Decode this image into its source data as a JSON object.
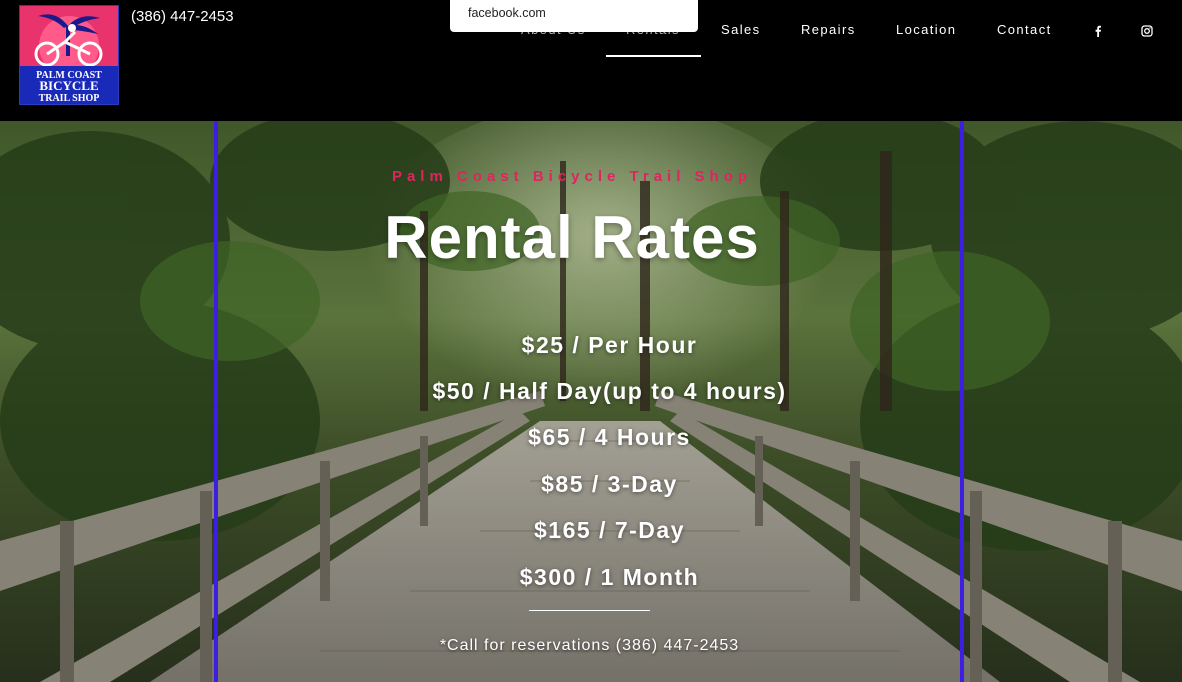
{
  "header": {
    "phone": "(386) 447-2453",
    "logo": {
      "line1": "PALM COAST",
      "line2": "BICYCLE",
      "line3": "TRAIL SHOP"
    },
    "nav": [
      {
        "label": "About Us"
      },
      {
        "label": "Rentals"
      },
      {
        "label": "Sales"
      },
      {
        "label": "Repairs"
      },
      {
        "label": "Location"
      },
      {
        "label": "Contact"
      }
    ],
    "active_nav": "Rentals",
    "social": [
      {
        "icon": "facebook-icon"
      },
      {
        "icon": "instagram-icon"
      }
    ],
    "tooltip": "facebook.com"
  },
  "hero": {
    "kicker": "Palm Coast Bicycle Trail Shop",
    "title": "Rental Rates",
    "rates": [
      "$25 / Per Hour",
      "$50 / Half Day(up to 4 hours)",
      "$65 / 4 Hours",
      "$85 / 3-Day",
      "$165 / 7-Day",
      "$300 / 1 Month"
    ],
    "note": "*Call for reservations (386) 447-2453"
  },
  "colors": {
    "accent_pink": "#e0245e",
    "frame_blue": "#3d1fe0",
    "header_bg": "#000000"
  }
}
